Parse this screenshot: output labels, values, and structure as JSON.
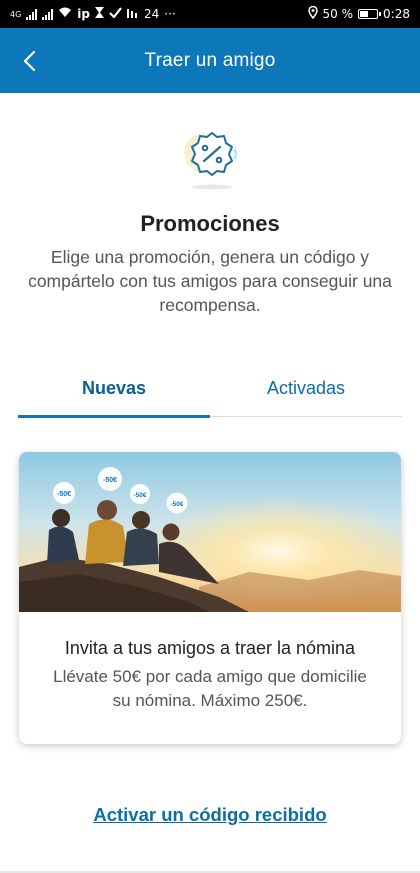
{
  "status_bar": {
    "left_items": [
      "4G",
      "ip",
      "24",
      "···"
    ],
    "battery_percent": "50 %",
    "time": "0:28"
  },
  "header": {
    "title": "Traer un amigo",
    "back_icon": "chevron-left-icon"
  },
  "hero": {
    "icon": "discount-badge-icon",
    "title": "Promociones",
    "description": "Elige una promoción, genera un código y compártelo con tus amigos para conseguir una recompensa."
  },
  "tabs": [
    {
      "label": "Nuevas",
      "active": true
    },
    {
      "label": "Activadas",
      "active": false
    }
  ],
  "promotion_card": {
    "bubble_label": "-50€",
    "title": "Invita a tus amigos a traer la nómina",
    "description": "Llévate 50€ por cada amigo que domicilie su nómina. Máximo 250€."
  },
  "activate_link": "Activar un código recibido",
  "colors": {
    "brand_blue": "#0c77b9",
    "link_blue": "#0c6ea8"
  }
}
